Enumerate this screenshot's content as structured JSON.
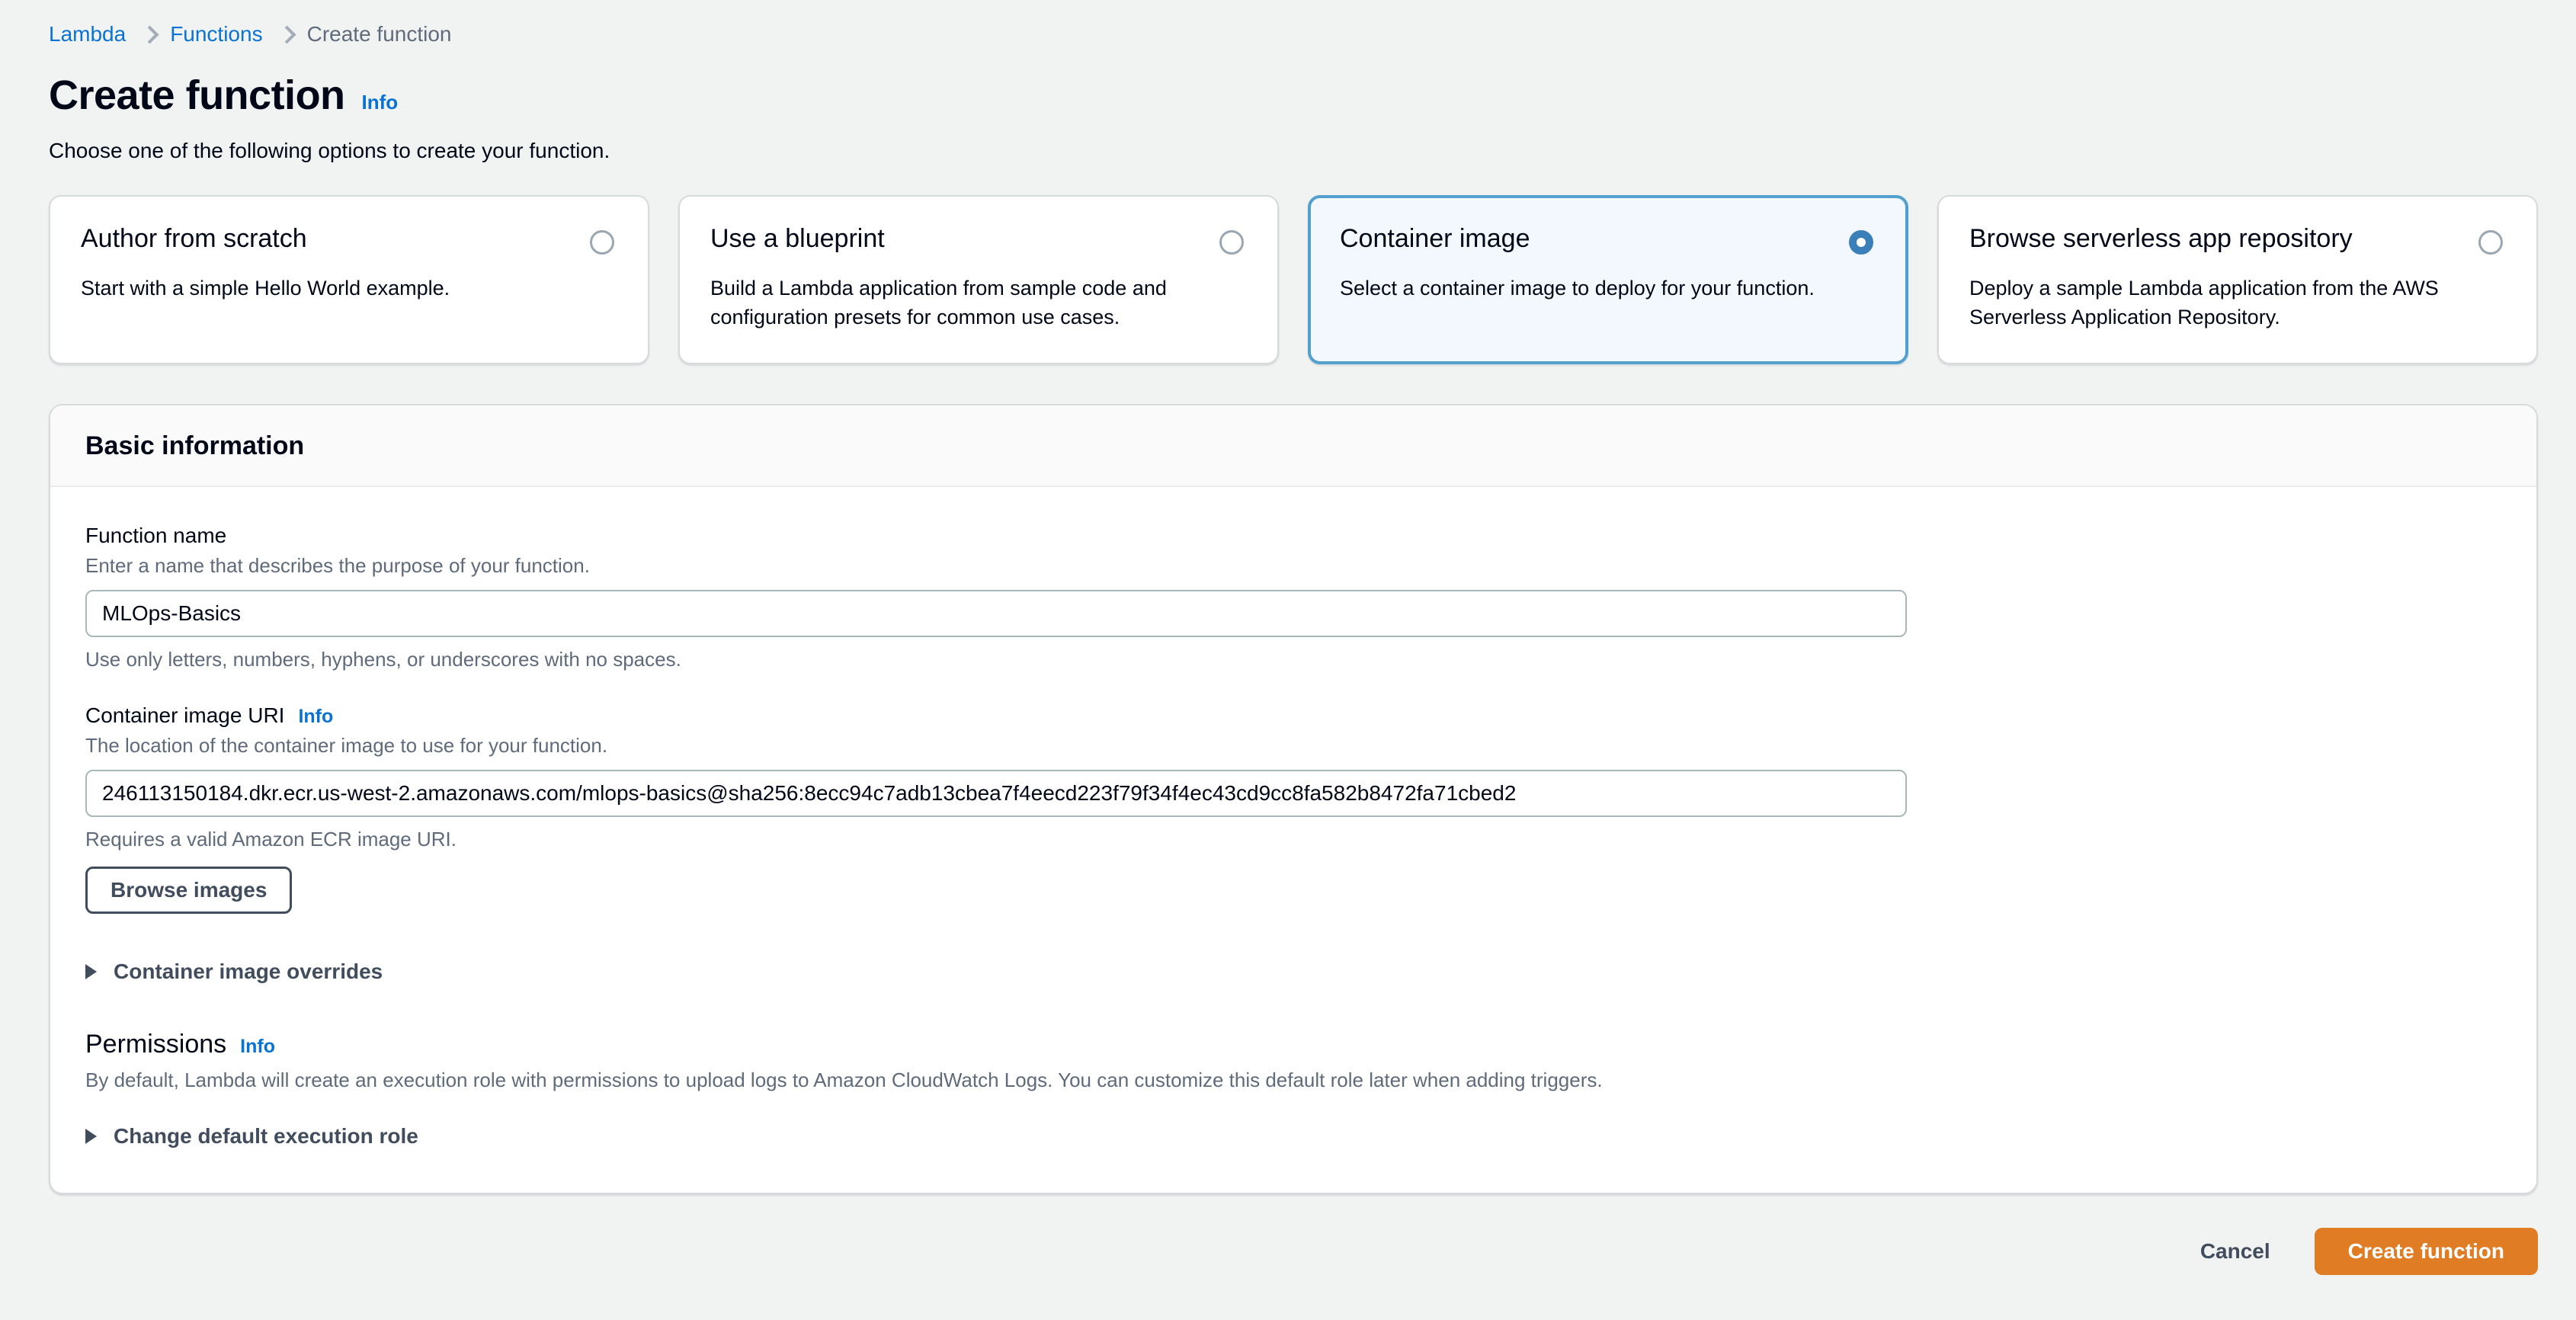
{
  "breadcrumb": {
    "items": [
      {
        "label": "Lambda",
        "current": false
      },
      {
        "label": "Functions",
        "current": false
      },
      {
        "label": "Create function",
        "current": true
      }
    ]
  },
  "header": {
    "title": "Create function",
    "info_label": "Info",
    "subtitle": "Choose one of the following options to create your function."
  },
  "options": [
    {
      "title": "Author from scratch",
      "description": "Start with a simple Hello World example.",
      "selected": false
    },
    {
      "title": "Use a blueprint",
      "description": "Build a Lambda application from sample code and configuration presets for common use cases.",
      "selected": false
    },
    {
      "title": "Container image",
      "description": "Select a container image to deploy for your function.",
      "selected": true
    },
    {
      "title": "Browse serverless app repository",
      "description": "Deploy a sample Lambda application from the AWS Serverless Application Repository.",
      "selected": false
    }
  ],
  "basic_information": {
    "panel_title": "Basic information",
    "function_name": {
      "label": "Function name",
      "hint": "Enter a name that describes the purpose of your function.",
      "value": "MLOps-Basics",
      "placeholder": "",
      "constraint": "Use only letters, numbers, hyphens, or underscores with no spaces."
    },
    "container_image_uri": {
      "label": "Container image URI",
      "info_label": "Info",
      "hint": "The location of the container image to use for your function.",
      "value": "246113150184.dkr.ecr.us-west-2.amazonaws.com/mlops-basics@sha256:8ecc94c7adb13cbea7f4eecd223f79f34f4ec43cd9cc8fa582b8472fa71cbed2",
      "placeholder": "",
      "constraint": "Requires a valid Amazon ECR image URI.",
      "browse_button": "Browse images"
    },
    "container_image_overrides": {
      "label": "Container image overrides",
      "expanded": false
    },
    "permissions": {
      "title": "Permissions",
      "info_label": "Info",
      "description": "By default, Lambda will create an execution role with permissions to upload logs to Amazon CloudWatch Logs. You can customize this default role later when adding triggers.",
      "change_role": {
        "label": "Change default execution role",
        "expanded": false
      }
    }
  },
  "footer": {
    "cancel_label": "Cancel",
    "create_label": "Create function"
  },
  "colors": {
    "link": "#0972d3",
    "primary_button": "#e07c24",
    "selected_card_bg": "#f2f8fd",
    "selected_card_border": "#539fcd",
    "radio_selected": "#3b7fb9",
    "page_bg": "#f1f3f3"
  }
}
